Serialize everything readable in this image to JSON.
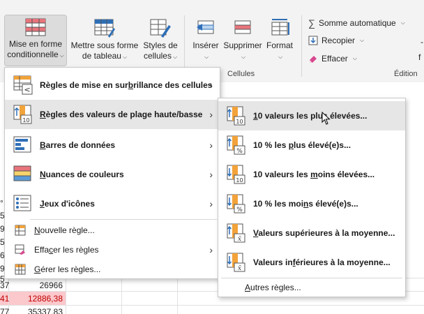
{
  "ribbon": {
    "mise_en_forme_1": "Mise en forme",
    "mise_en_forme_2": "conditionnelle",
    "mettre_sous_forme_1": "Mettre sous forme",
    "mettre_sous_forme_2": "de tableau",
    "styles_1": "Styles de",
    "styles_2": "cellules",
    "inserer": "Insérer",
    "supprimer": "Supprimer",
    "format": "Format",
    "group_cellules": "Cellules",
    "somme_auto": "Somme automatique",
    "recopier": "Recopier",
    "effacer": "Effacer",
    "group_edition": "Édition",
    "right_frag_1": "-",
    "right_frag_2": "f"
  },
  "sheet": {
    "row_labels": [
      "°",
      "5",
      "9",
      "5",
      "6",
      "9",
      "5",
      "2",
      "37",
      "41",
      "77"
    ],
    "values": [
      "26966",
      "12886,38",
      "35337,83"
    ],
    "highlight_color": "#fbc8cc",
    "value_highlight_text_color": "#c00000"
  },
  "main_menu": {
    "items": [
      {
        "pre": "Règles de mise en sur",
        "ul": "b",
        "post": "rillance des cellules",
        "icon": "highlight-rules-icon"
      },
      {
        "pre": "",
        "ul": "R",
        "post": "ègles des valeurs de plage haute/basse",
        "icon": "top-bottom-rules-icon"
      },
      {
        "pre": "",
        "ul": "B",
        "post": "arres de données",
        "icon": "data-bars-icon"
      },
      {
        "pre": "",
        "ul": "N",
        "post": "uances de couleurs",
        "icon": "color-scales-icon"
      },
      {
        "pre": "",
        "ul": "J",
        "post": "eux d'icônes",
        "icon": "icon-sets-icon"
      },
      {
        "pre": "",
        "ul": "N",
        "post": "ouvelle règle...",
        "icon": "new-rule-icon"
      },
      {
        "pre": "Effa",
        "ul": "c",
        "post": "er les règles",
        "icon": "clear-rules-icon"
      },
      {
        "pre": "",
        "ul": "G",
        "post": "érer les règles...",
        "icon": "manage-rules-icon"
      }
    ]
  },
  "sub_menu": {
    "items": [
      {
        "pre": "",
        "ul": "1",
        "post": "0 valeurs les plus élevées...",
        "icon": "top-10-icon"
      },
      {
        "pre": "10 % les ",
        "ul": "p",
        "post": "lus élevé(e)s...",
        "icon": "top-10-percent-icon"
      },
      {
        "pre": "10 valeurs les ",
        "ul": "m",
        "post": "oins élevées...",
        "icon": "bottom-10-icon"
      },
      {
        "pre": "10 % les moi",
        "ul": "n",
        "post": "s élevé(e)s...",
        "icon": "bottom-10-percent-icon"
      },
      {
        "pre": "",
        "ul": "V",
        "post": "aleurs supérieures à la moyenne...",
        "icon": "above-average-icon"
      },
      {
        "pre": "Valeurs in",
        "ul": "f",
        "post": "érieures à la moyenne...",
        "icon": "below-average-icon"
      },
      {
        "pre": "",
        "ul": "A",
        "post": "utres règles...",
        "icon": ""
      }
    ]
  },
  "colors": {
    "ribbon_bg": "#f3f3f3",
    "menu_highlight": "#e6e6e6",
    "icon_blue": "#2f6fb7",
    "icon_red": "#e8747c",
    "icon_orange": "#f2a33a"
  }
}
